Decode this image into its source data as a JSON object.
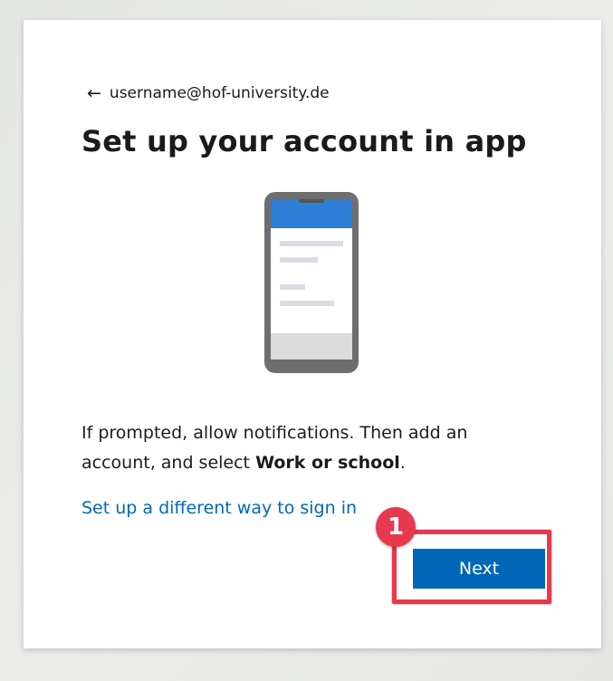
{
  "identity": {
    "back_icon": "left-arrow-icon",
    "email": "username@hof-university.de"
  },
  "page": {
    "title": "Set up your account in app"
  },
  "illustration": {
    "icon": "phone-illustration-icon",
    "colors": {
      "frame": "#6e6e6e",
      "header": "#2f7fd8",
      "screen": "#ffffff",
      "lines": "#d9dde3",
      "footer": "#dcdcdc"
    }
  },
  "instructions": {
    "text_before": "If prompted, allow notifications. Then add an account, and select ",
    "text_bold": "Work or school",
    "text_after": "."
  },
  "links": {
    "alternate_signin": "Set up a different way to sign in"
  },
  "buttons": {
    "next": "Next"
  },
  "annotation": {
    "step_number": "1",
    "color": "#e8384f"
  },
  "colors": {
    "accent": "#0067b8",
    "text": "#1b1b1b",
    "annotation": "#e8384f"
  }
}
